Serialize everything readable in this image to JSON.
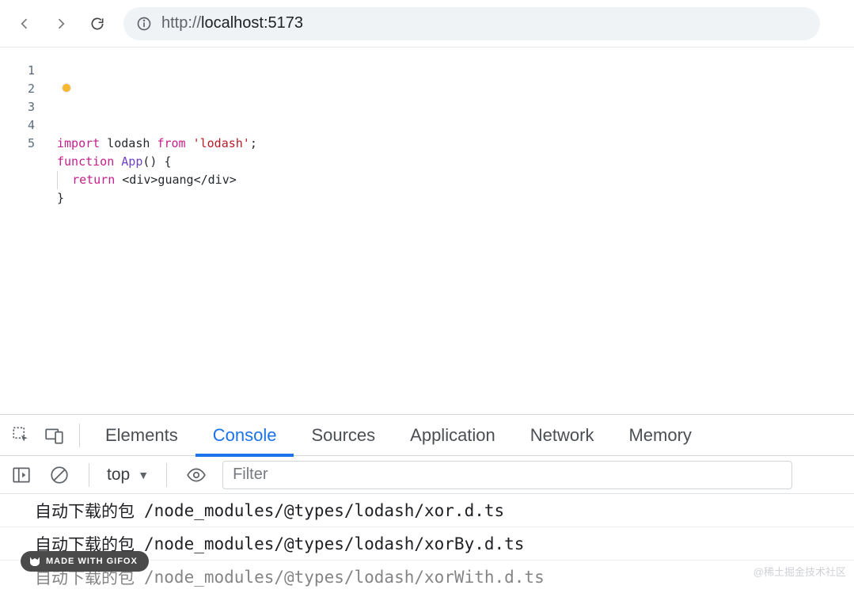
{
  "browser": {
    "url_dim": "http://",
    "url_main": "localhost:5173"
  },
  "editor": {
    "lines": [
      {
        "n": "1",
        "html": "<span class='kw'>import</span> <span class='id'>lodash</span> <span class='kw'>from</span> <span class='str'>'lodash'</span><span class='sym'>;</span>"
      },
      {
        "n": "2",
        "html": "<span class='kw'>function</span> <span class='fn'>App</span><span class='sym'>() {</span>"
      },
      {
        "n": "3",
        "html": "<span class='indent'></span>  <span class='kw'>return</span> <span class='sym'>&lt;div&gt;guang&lt;/div&gt;</span>"
      },
      {
        "n": "4",
        "html": "<span class='sym'>}</span>"
      },
      {
        "n": "5",
        "html": ""
      }
    ]
  },
  "devtools": {
    "tabs": [
      "Elements",
      "Console",
      "Sources",
      "Application",
      "Network",
      "Memory"
    ],
    "active_tab": "Console",
    "context": "top",
    "filter_placeholder": "Filter",
    "logs": [
      {
        "label": "自动下载的包",
        "path": "/node_modules/@types/lodash/xor.d.ts"
      },
      {
        "label": "自动下载的包",
        "path": "/node_modules/@types/lodash/xorBy.d.ts"
      },
      {
        "label": "自动下载的包",
        "path": "/node_modules/@types/lodash/xorWith.d.ts",
        "partial": true
      }
    ]
  },
  "badge": "MADE WITH GIFOX",
  "watermark": "@稀土掘金技术社区"
}
